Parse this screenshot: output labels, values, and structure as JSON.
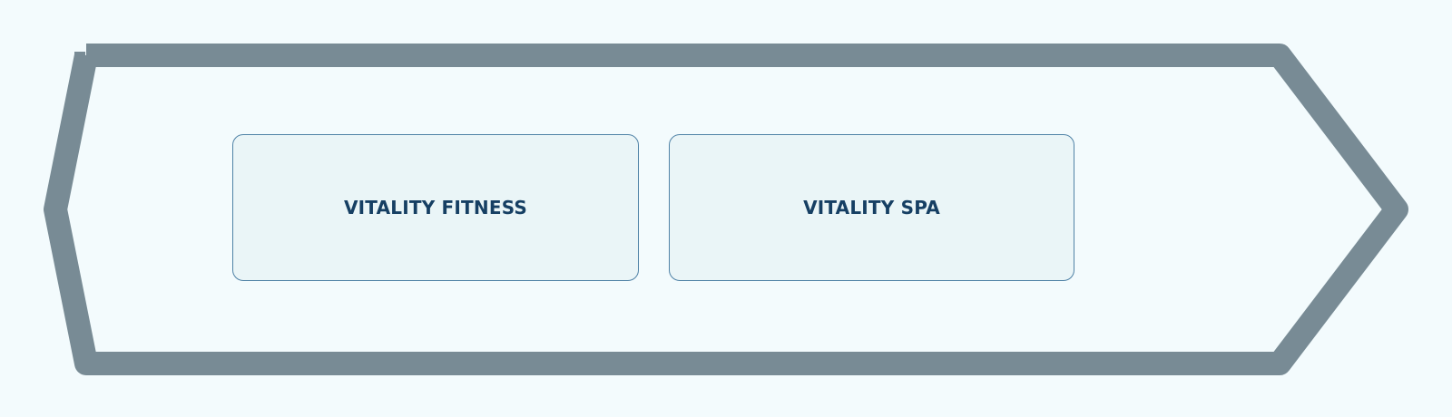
{
  "colors": {
    "background": "#f3fbfd",
    "banner_outline": "#788b95",
    "card_fill": "#eaf5f7",
    "card_border": "#4f82a6",
    "card_text": "#163f63"
  },
  "cards": [
    {
      "label": "VITALITY FITNESS"
    },
    {
      "label": "VITALITY SPA"
    }
  ]
}
